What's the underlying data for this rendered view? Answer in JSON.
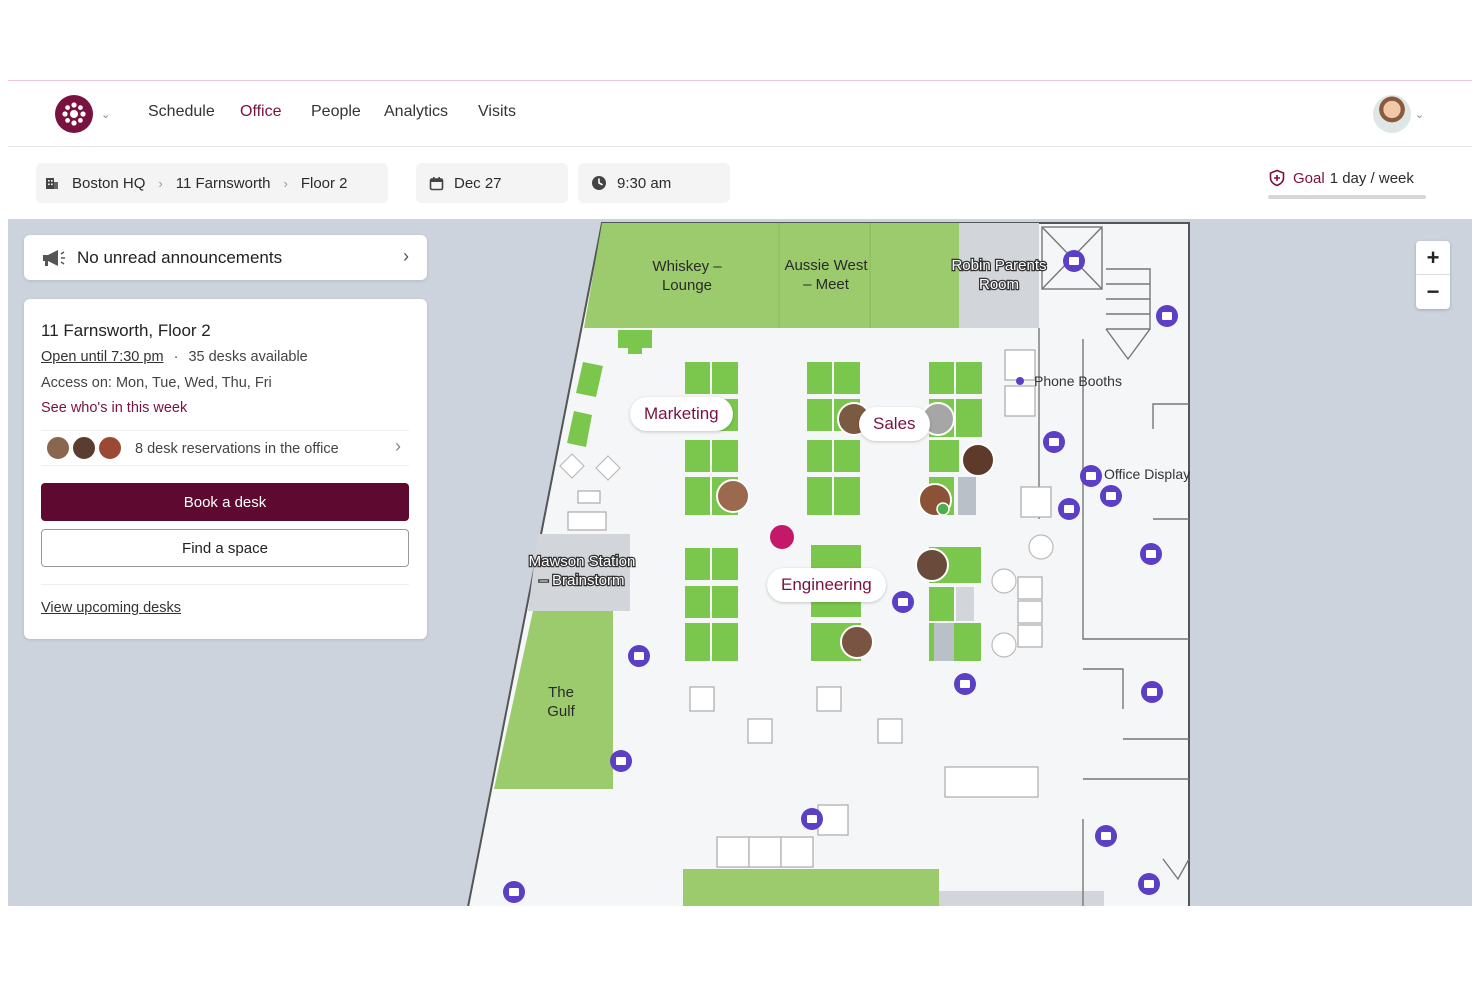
{
  "nav": {
    "links": [
      "Schedule",
      "Office",
      "People",
      "Analytics",
      "Visits"
    ],
    "active": "Office"
  },
  "breadcrumb": [
    "Boston HQ",
    "11 Farnsworth",
    "Floor 2"
  ],
  "date": "Dec 27",
  "time": "9:30 am",
  "goal": {
    "label": "Goal",
    "value": "1 day / week"
  },
  "announcements": {
    "text": "No unread announcements"
  },
  "office_card": {
    "title": "11 Farnsworth, Floor 2",
    "open_until": "Open until 7:30 pm",
    "dot": "·",
    "desks_available": "35 desks available",
    "access": "Access on: Mon, Tue, Wed, Thu, Fri",
    "see_whos_in": "See who's in this week",
    "reservations": "8 desk reservations in the office",
    "book_desk": "Book a desk",
    "find_space": "Find a space",
    "view_upcoming": "View upcoming desks"
  },
  "map": {
    "rooms": {
      "whiskey_1": "Whiskey –",
      "whiskey_2": "Lounge",
      "aussie_1": "Aussie West",
      "aussie_2": "– Meet",
      "robin_1": "Robin Parents",
      "robin_2": "Room",
      "mawson_1": "Mawson Station",
      "mawson_2": "– Brainstorm",
      "gulf_1": "The",
      "gulf_2": "Gulf"
    },
    "neighborhoods": {
      "marketing": "Marketing",
      "sales": "Sales",
      "engineering": "Engineering"
    },
    "labels": {
      "phone_booths": "Phone Booths",
      "office_display": "Office Display"
    },
    "zoom_in": "+",
    "zoom_out": "−"
  },
  "colors": {
    "brand": "#7a1240",
    "primary_button": "#5e0a30",
    "room_green": "#9bcb6c",
    "desk_green": "#7bc74d",
    "marker_purple": "#5b3fc4",
    "map_bg": "#ccd3dc",
    "floor": "#f5f6f7"
  },
  "icons": {
    "logo": "brand-logo",
    "building": "building-icon",
    "calendar": "calendar-icon",
    "clock": "clock-icon",
    "goal": "shield-plus-icon",
    "megaphone": "megaphone-icon"
  }
}
